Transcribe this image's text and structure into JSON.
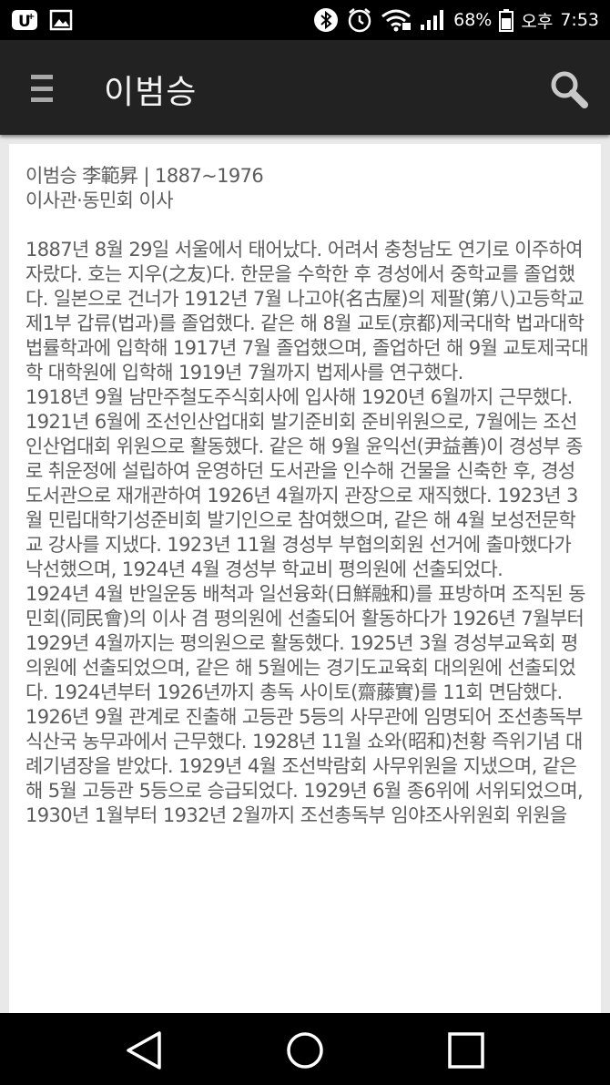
{
  "status_bar": {
    "battery_percent": "68%",
    "ampm": "오후",
    "time": "7:53",
    "icons": [
      "u-plus-icon",
      "gallery-icon",
      "bluetooth-icon",
      "alarm-icon",
      "wifi-icon",
      "signal-icon",
      "battery-icon"
    ]
  },
  "app_bar": {
    "title": "이범승",
    "menu_icon": "hamburger-menu-icon",
    "search_icon": "search-icon"
  },
  "article": {
    "heading": "이범승 李範昇 | 1887~1976",
    "subheading": "이사관·동민회 이사",
    "paragraphs": [
      "1887년 8월 29일 서울에서 태어났다. 어려서 충청남도 연기로 이주하여 자랐다. 호는 지우(之友)다. 한문을 수학한 후 경성에서 중학교를 졸업했다. 일본으로 건너가 1912년 7월 나고야(名古屋)의 제팔(第八)고등학교 제1부 갑류(법과)를 졸업했다. 같은 해 8월 교토(京都)제국대학 법과대학 법률학과에 입학해 1917년 7월 졸업했으며, 졸업하던 해 9월 교토제국대학 대학원에 입학해 1919년 7월까지 법제사를 연구했다.",
      "1918년 9월 남만주철도주식회사에 입사해 1920년 6월까지 근무했다. 1921년 6월에 조선인산업대회 발기준비회 준비위원으로, 7월에는 조선인산업대회 위원으로 활동했다. 같은 해 9월 윤익선(尹益善)이 경성부 종로 취운정에 설립하여 운영하던 도서관을 인수해 건물을 신축한 후, 경성도서관으로 재개관하여 1926년 4월까지 관장으로 재직했다. 1923년 3월 민립대학기성준비회 발기인으로 참여했으며, 같은 해 4월 보성전문학교 강사를 지냈다. 1923년 11월 경성부 부협의회원 선거에 출마했다가 낙선했으며, 1924년 4월 경성부 학교비 평의원에 선출되었다.",
      "1924년 4월 반일운동 배척과 일선융화(日鮮融和)를 표방하며 조직된 동민회(同民會)의 이사 겸 평의원에 선출되어 활동하다가 1926년 7월부터 1929년 4월까지는 평의원으로 활동했다. 1925년 3월 경성부교육회 평의원에 선출되었으며, 같은 해 5월에는 경기도교육회 대의원에 선출되었다. 1924년부터 1926년까지 총독 사이토(齋藤實)를 11회 면담했다.",
      "1926년 9월 관계로 진출해 고등관 5등의 사무관에 임명되어 조선총독부 식산국 농무과에서 근무했다. 1928년 11월 쇼와(昭和)천황 즉위기념 대례기념장을 받았다. 1929년 4월 조선박람회 사무위원을 지냈으며, 같은 해 5월 고등관 5등으로 승급되었다. 1929년 6월 종6위에 서위되었으며, 1930년 1월부터 1932년 2월까지 조선총독부 임야조사위원회 위원을"
    ]
  },
  "nav_bar": {
    "icons": [
      "back-icon",
      "home-icon",
      "recents-icon"
    ]
  }
}
